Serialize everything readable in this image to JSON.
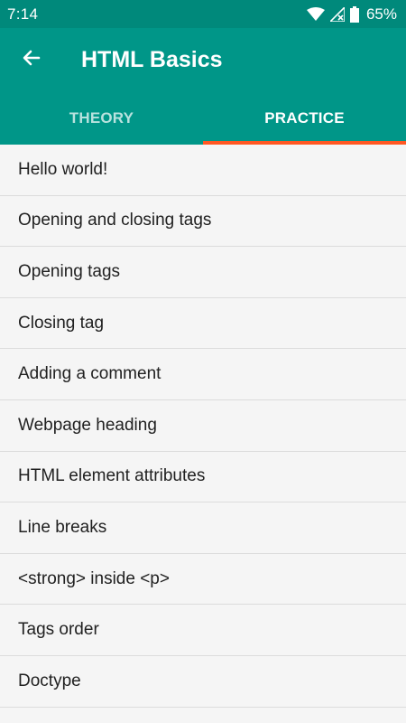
{
  "status_bar": {
    "time": "7:14",
    "battery": "65%",
    "icons": [
      "wifi-icon",
      "signal-icon",
      "battery-icon"
    ]
  },
  "toolbar": {
    "title": "HTML Basics",
    "back_icon": "arrow-back-icon"
  },
  "tabs": [
    {
      "label": "THEORY",
      "active": false
    },
    {
      "label": "PRACTICE",
      "active": true
    }
  ],
  "lessons": [
    "Hello world!",
    "Opening and closing tags",
    "Opening tags",
    "Closing tag",
    "Adding a comment",
    "Webpage heading",
    "HTML element attributes",
    "Line breaks",
    "<strong> inside <p>",
    "Tags order",
    "Doctype"
  ],
  "colors": {
    "app_bar": "#009688",
    "status_bar": "#00897b",
    "tab_indicator": "#ff5722",
    "list_background": "#f5f5f5"
  }
}
